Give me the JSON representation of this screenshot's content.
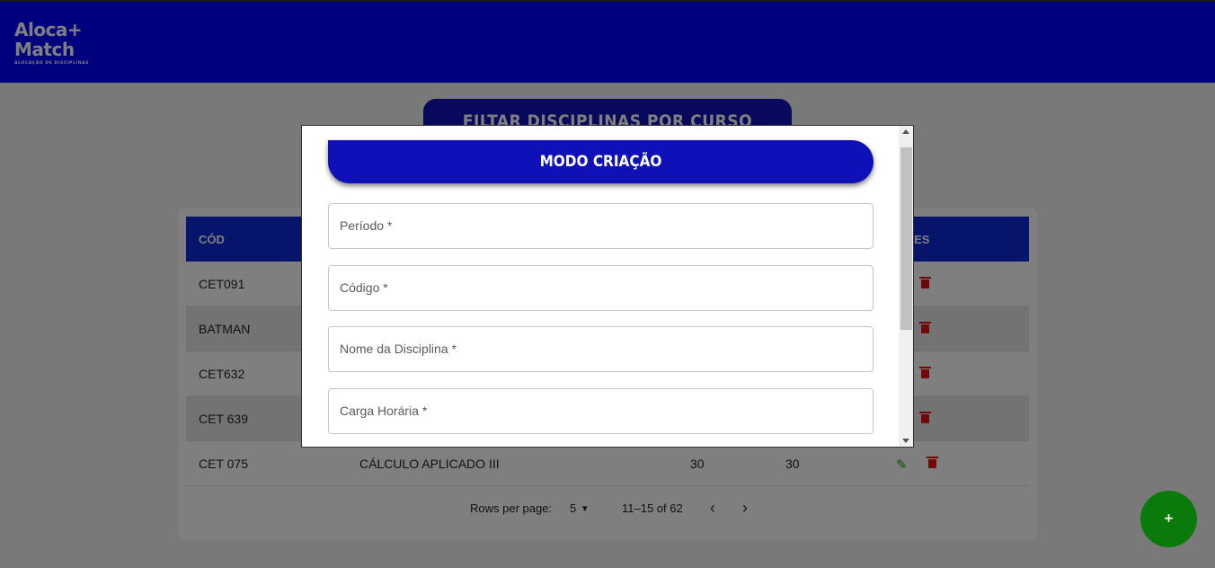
{
  "header": {
    "logo_line1": "Aloca+",
    "logo_line2": "Match",
    "logo_sub": "ALOCAÇÃO DE DISCIPLINAS",
    "bg_color": "#0000ff"
  },
  "filter_button": {
    "label": "FILTAR DISCIPLINAS POR CURSO"
  },
  "table": {
    "columns": {
      "cod": "CÓD",
      "acoes": "ÕES"
    },
    "rows": [
      {
        "cod": "CET091"
      },
      {
        "cod": "BATMAN"
      },
      {
        "cod": "CET632"
      },
      {
        "cod": "CET 639"
      },
      {
        "cod": "CET 075",
        "nome": "CÁLCULO APLICADO III",
        "ch1": "30",
        "ch2": "30"
      }
    ],
    "edit_icon": "✎"
  },
  "pagination": {
    "rows_label": "Rows per page:",
    "rows_value": "5",
    "range": "11–15 of 62",
    "prev": "‹",
    "next": "›",
    "dropdown_caret": "▾"
  },
  "fab": {
    "label": "+"
  },
  "modal": {
    "title": "MODO CRIAÇÃO",
    "fields": [
      {
        "label": "Período *"
      },
      {
        "label": "Código *"
      },
      {
        "label": "Nome da Disciplina *"
      },
      {
        "label": "Carga Horária *"
      }
    ]
  }
}
